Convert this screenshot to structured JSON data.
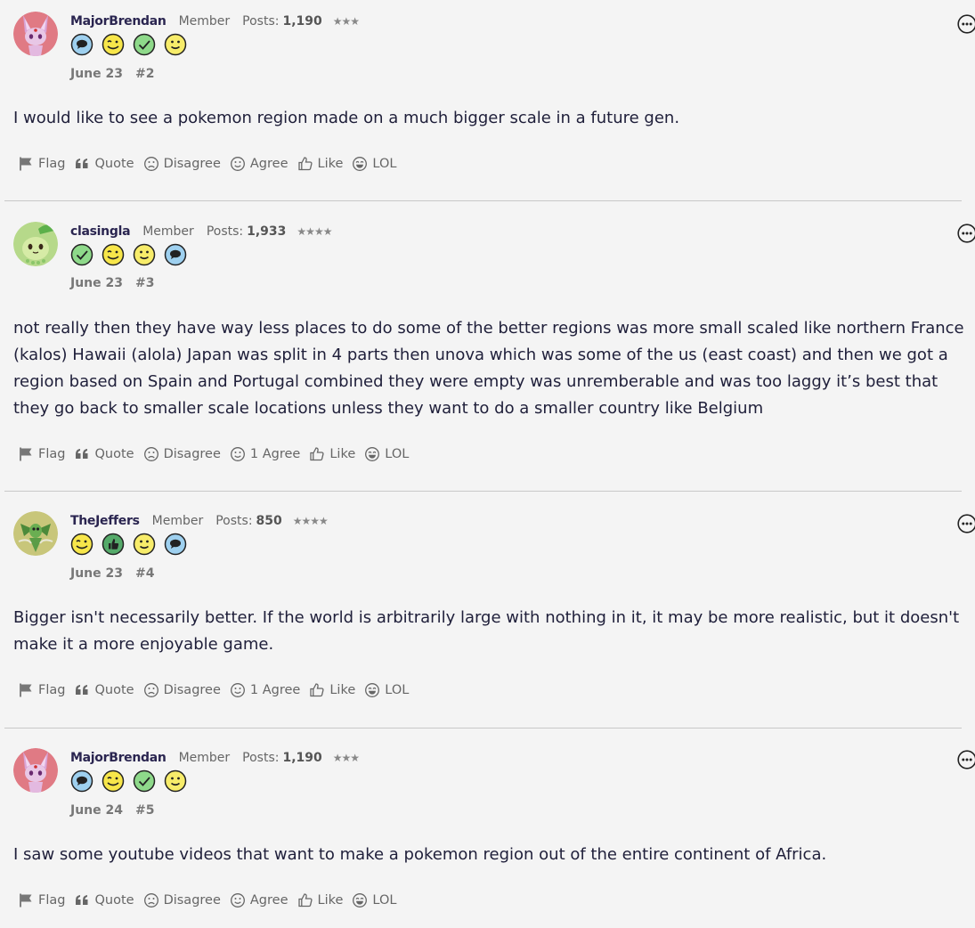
{
  "posts": [
    {
      "username": "MajorBrendan",
      "role": "Member",
      "posts_label": "Posts:",
      "posts_count": "1,190",
      "stars": "★★★",
      "date": "June 23",
      "number": "#2",
      "avatar": "espeon-avatar",
      "badges": [
        "speech-bubble-icon",
        "wink-face-icon",
        "check-icon",
        "smile-face-icon"
      ],
      "body": "I would like to see a pokemon region made on a much bigger scale in a future gen.",
      "agree_label": "Agree"
    },
    {
      "username": "clasingla",
      "role": "Member",
      "posts_label": "Posts:",
      "posts_count": "1,933",
      "stars": "★★★★",
      "date": "June 23",
      "number": "#3",
      "avatar": "chikorita-avatar",
      "badges": [
        "check-icon",
        "wink-face-icon",
        "smile-face-icon",
        "speech-bubble-icon"
      ],
      "body": "not really then they have way less places to do some of the better regions was more small scaled like northern France (kalos) Hawaii (alola) Japan was split in 4 parts then unova which was some of the us (east coast) and then we got a region based on Spain and Portugal combined they were empty was unremberable and was too laggy it’s best that they go back to smaller scale locations unless they want to do a smaller country like Belgium",
      "agree_label": "1 Agree"
    },
    {
      "username": "TheJeffers",
      "role": "Member",
      "posts_label": "Posts:",
      "posts_count": "850",
      "stars": "★★★★",
      "date": "June 23",
      "number": "#4",
      "avatar": "scyther-avatar",
      "badges": [
        "wink-face-icon",
        "thumbs-up-icon",
        "smile-face-icon",
        "speech-bubble-icon"
      ],
      "body": "Bigger isn't necessarily better. If the world is arbitrarily large with nothing in it, it may be more realistic, but it doesn't make it a more enjoyable game.",
      "agree_label": "1 Agree"
    },
    {
      "username": "MajorBrendan",
      "role": "Member",
      "posts_label": "Posts:",
      "posts_count": "1,190",
      "stars": "★★★",
      "date": "June 24",
      "number": "#5",
      "avatar": "espeon-avatar",
      "badges": [
        "speech-bubble-icon",
        "wink-face-icon",
        "check-icon",
        "smile-face-icon"
      ],
      "body": "I saw some youtube videos that want to make a pokemon region out of the entire continent of Africa.",
      "agree_label": "Agree"
    }
  ],
  "actions": {
    "flag": "Flag",
    "quote": "Quote",
    "disagree": "Disagree",
    "like": "Like",
    "lol": "LOL"
  },
  "colors": {
    "background": "#f4f4f4",
    "text": "#1f1f3a",
    "muted": "#666666",
    "separator": "#c8c8c8"
  }
}
